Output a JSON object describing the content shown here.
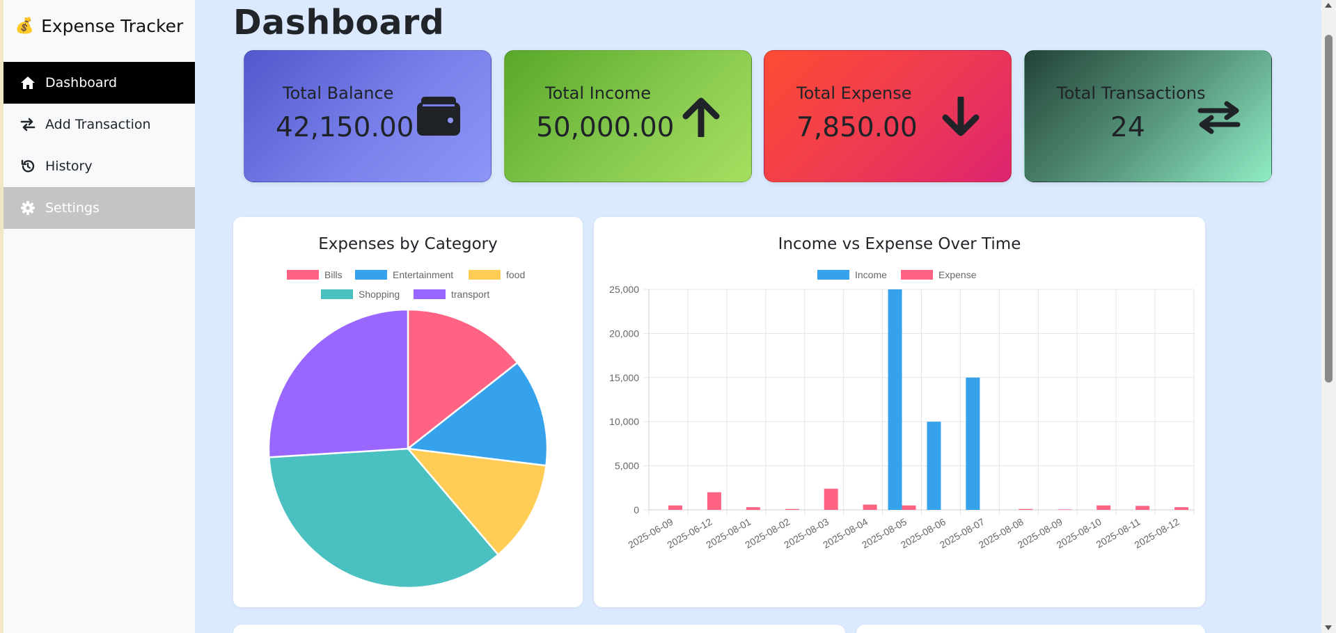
{
  "app": {
    "brand_icon": "💰",
    "title": "Expense Tracker"
  },
  "sidebar": {
    "items": [
      {
        "label": "Dashboard",
        "icon": "home-icon",
        "state": "active"
      },
      {
        "label": "Add Transaction",
        "icon": "exchange-icon",
        "state": "normal"
      },
      {
        "label": "History",
        "icon": "history-icon",
        "state": "normal"
      },
      {
        "label": "Settings",
        "icon": "gear-icon",
        "state": "hover"
      }
    ]
  },
  "page": {
    "title": "Dashboard"
  },
  "cards": {
    "balance": {
      "label": "Total Balance",
      "value": "42,150.00",
      "icon": "wallet-icon"
    },
    "income": {
      "label": "Total Income",
      "value": "50,000.00",
      "icon": "arrow-up-icon"
    },
    "expense": {
      "label": "Total Expense",
      "value": "7,850.00",
      "icon": "arrow-down-icon"
    },
    "transactions": {
      "label": "Total Transactions",
      "value": "24",
      "icon": "swap-arrows-icon"
    }
  },
  "colors": {
    "income": "#36a2eb",
    "expense": "#ff6384",
    "bills": "#ff6384",
    "entertainment": "#36a2eb",
    "food": "#ffcd56",
    "shopping": "#4bc0c0",
    "transport": "#9966ff"
  },
  "chart_data": [
    {
      "type": "pie",
      "title": "Expenses by Category",
      "legend_position": "top",
      "categories": [
        "Bills",
        "Entertainment",
        "food",
        "Shopping",
        "transport"
      ],
      "values": [
        1130,
        985,
        930,
        2765,
        2040
      ],
      "colors": [
        "#ff6384",
        "#36a2eb",
        "#ffcd56",
        "#4bc0c0",
        "#9966ff"
      ]
    },
    {
      "type": "bar",
      "title": "Income vs Expense Over Time",
      "legend_position": "top",
      "categories": [
        "2025-06-09",
        "2025-06-12",
        "2025-08-01",
        "2025-08-02",
        "2025-08-03",
        "2025-08-04",
        "2025-08-05",
        "2025-08-06",
        "2025-08-07",
        "2025-08-08",
        "2025-08-09",
        "2025-08-10",
        "2025-08-11",
        "2025-08-12"
      ],
      "series": [
        {
          "name": "Income",
          "color": "#36a2eb",
          "values": [
            0,
            0,
            0,
            0,
            0,
            0,
            25000,
            10000,
            15000,
            0,
            0,
            0,
            0,
            0
          ]
        },
        {
          "name": "Expense",
          "color": "#ff6384",
          "values": [
            500,
            2000,
            300,
            100,
            2400,
            600,
            500,
            0,
            0,
            100,
            50,
            500,
            450,
            300
          ]
        }
      ],
      "ylim": [
        0,
        25000
      ],
      "yticks": [
        "25,000",
        "20,000",
        "15,000",
        "10,000",
        "5,000",
        "0"
      ],
      "grid": true
    }
  ]
}
